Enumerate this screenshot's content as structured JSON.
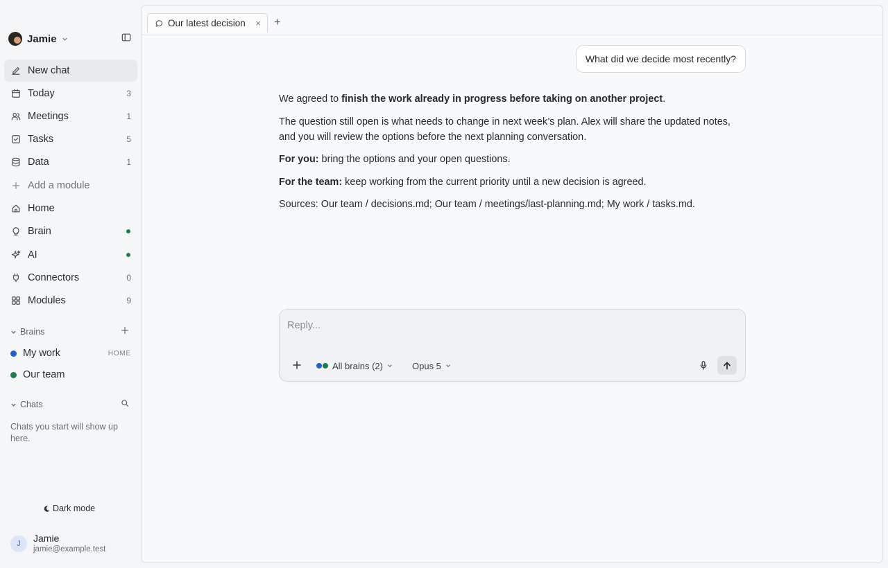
{
  "workspace": {
    "name": "Jamie",
    "avatar_icon": "workspace-avatar-icon"
  },
  "nav": {
    "new_chat": "New chat",
    "items": [
      {
        "label": "Today",
        "count": "3",
        "icon": "calendar-icon"
      },
      {
        "label": "Meetings",
        "count": "1",
        "icon": "users-icon"
      },
      {
        "label": "Tasks",
        "count": "5",
        "icon": "checkbox-icon"
      },
      {
        "label": "Data",
        "count": "1",
        "icon": "database-icon"
      }
    ],
    "add_module": "Add a module",
    "home": "Home",
    "brain": "Brain",
    "ai": "AI",
    "connectors": "Connectors",
    "connectors_count": "0",
    "modules": "Modules",
    "modules_count": "9",
    "status_color": "#1a7f4b"
  },
  "brains": {
    "heading": "Brains",
    "items": [
      {
        "label": "My work",
        "tag": "HOME",
        "color": "#1f5fd1"
      },
      {
        "label": "Our team",
        "tag": "",
        "color": "#1a7f4b"
      }
    ]
  },
  "chats": {
    "heading": "Chats",
    "empty_text": "Chats you start will show up here."
  },
  "footer": {
    "dark_mode": "Dark mode",
    "user_name": "Jamie",
    "user_email": "jamie@example.test",
    "user_initial": "J"
  },
  "tab": {
    "title": "Our latest decision"
  },
  "conversation": {
    "user_message": "What did we decide most recently?",
    "answer": {
      "p1_prefix": "We agreed to ",
      "p1_bold": "finish the work already in progress before taking on another project",
      "p1_suffix": ".",
      "p2": "The question still open is what needs to change in next week’s plan. Alex will share the updated notes, and you will review the options before the next planning conversation.",
      "p3_bold": "For you:",
      "p3": " bring the options and your open questions.",
      "p4_bold": "For the team:",
      "p4": " keep working from the current priority until a new decision is agreed.",
      "p5": "Sources: Our team / decisions.md; Our team / meetings/last-planning.md; My work / tasks.md."
    }
  },
  "composer": {
    "placeholder": "Reply...",
    "brains_selector": "All brains (2)",
    "model_selector": "Opus 5"
  }
}
